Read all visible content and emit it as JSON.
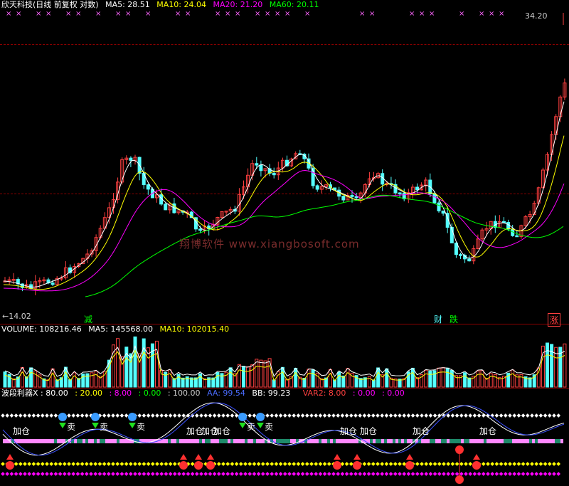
{
  "price": {
    "title": "欣天科技(日线 前复权 对数)",
    "ma5": "MA5: 28.51",
    "ma10": "MA10: 24.04",
    "ma20": "MA20: 21.20",
    "ma60": "MA60: 20.11",
    "high_label": "34.20",
    "low_label": "←14.02",
    "signals": [
      "减",
      "财",
      "跌",
      "涨"
    ],
    "watermark": "翔博软件 www.xiangbosoft.com"
  },
  "volume": {
    "volume": "VOLUME: 108216.46",
    "ma5": "MA5: 145568.00",
    "ma10": "MA10: 102015.40"
  },
  "oscillator": {
    "name": "波段利器X",
    "v1": ": 80.00",
    "v2": ": 20.00",
    "v3": ": 8.00",
    "v4": ": 0.00",
    "v5": ": 100.00",
    "aa": "AA: 99.54",
    "bb": "BB: 99.23",
    "var2": "VAR2: 8.00",
    "v6": ": 0.00",
    "v7": ": 0.00",
    "add_label": "加仓",
    "sell_label": "卖"
  },
  "colors": {
    "up": "#ff4040",
    "down": "#54ffff",
    "ma5": "#ffffff",
    "ma10": "#ffff00",
    "ma20": "#ff00ff",
    "ma60": "#00ff00",
    "grid": "#8b0000"
  }
}
